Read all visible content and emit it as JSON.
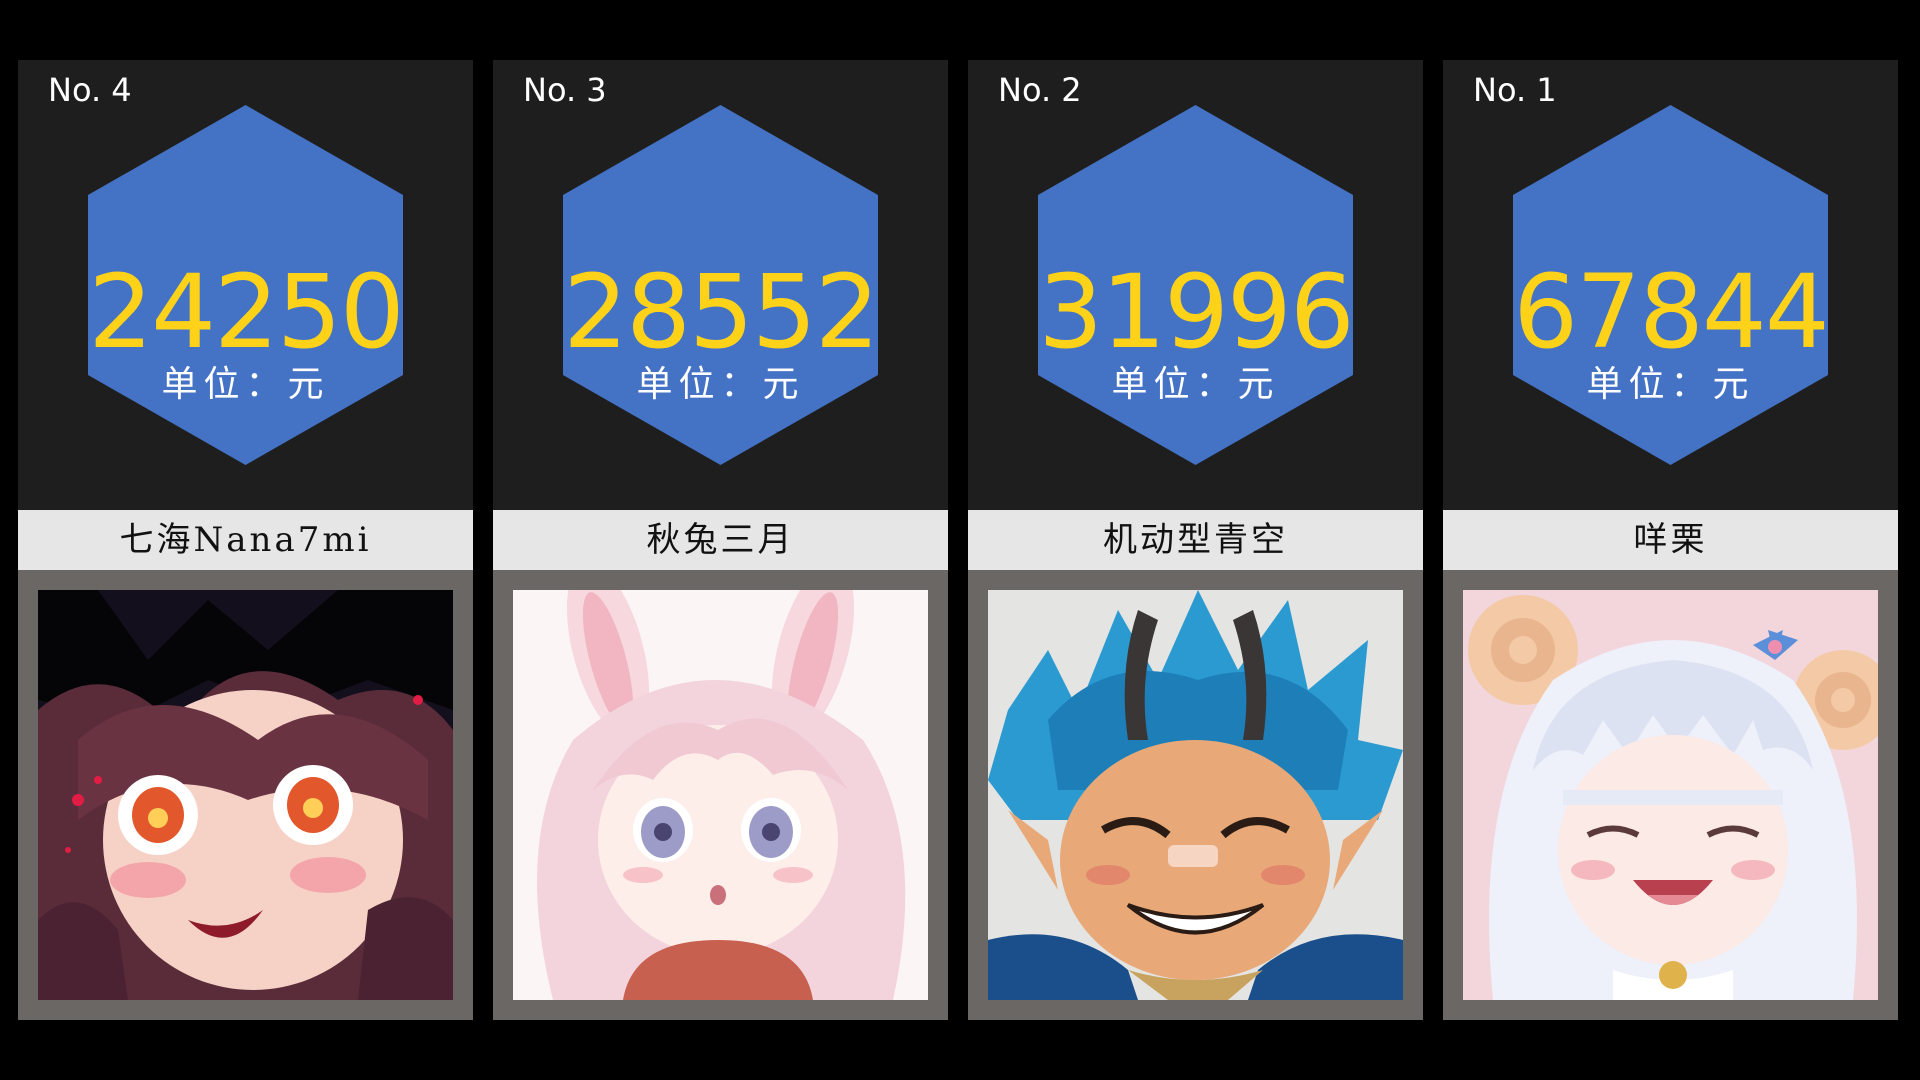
{
  "theme": {
    "hex_color": "#4472c4",
    "value_color": "#ffd21a",
    "panel_color": "#1e1e1e",
    "name_band_color": "#e6e6e6",
    "frame_color": "#6b6764"
  },
  "cards": [
    {
      "rank": "No. 4",
      "value": "24250",
      "unit": "单位：元",
      "name": "七海Nana7mi",
      "avatar_icon": "avatar-dark-hair-girl"
    },
    {
      "rank": "No. 3",
      "value": "28552",
      "unit": "单位：元",
      "name": "秋兔三月",
      "avatar_icon": "avatar-pink-bunny-girl"
    },
    {
      "rank": "No. 2",
      "value": "31996",
      "unit": "单位：元",
      "name": "机动型青空",
      "avatar_icon": "avatar-blue-hair-horned-boy"
    },
    {
      "rank": "No. 1",
      "value": "67844",
      "unit": "单位：元",
      "name": "咩栗",
      "avatar_icon": "avatar-white-hair-sheep-girl"
    }
  ]
}
